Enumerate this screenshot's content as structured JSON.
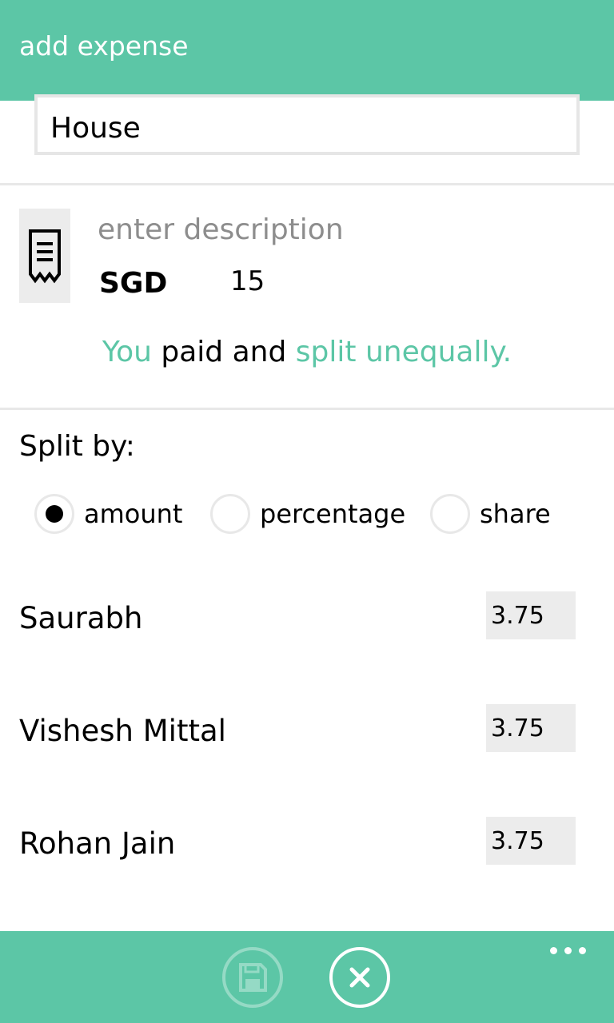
{
  "header": {
    "title": "add expense"
  },
  "group": {
    "value": "House"
  },
  "expense": {
    "description_placeholder": "enter description",
    "currency": "SGD",
    "amount": "15"
  },
  "summary": {
    "payer": "You",
    "middle": " paid and ",
    "split_text": "split unequally."
  },
  "split": {
    "label": "Split by:",
    "options": [
      "amount",
      "percentage",
      "share"
    ],
    "selected": "amount"
  },
  "people": [
    {
      "name": "Saurabh",
      "value": "3.75"
    },
    {
      "name": "Vishesh Mittal",
      "value": "3.75"
    },
    {
      "name": "Rohan Jain",
      "value": "3.75"
    }
  ],
  "appbar": {
    "icons": [
      "save-icon",
      "close-icon",
      "more-icon"
    ]
  },
  "colors": {
    "accent": "#5cc6a6",
    "field_bg": "#ececec",
    "divider": "#e8e8e8"
  }
}
